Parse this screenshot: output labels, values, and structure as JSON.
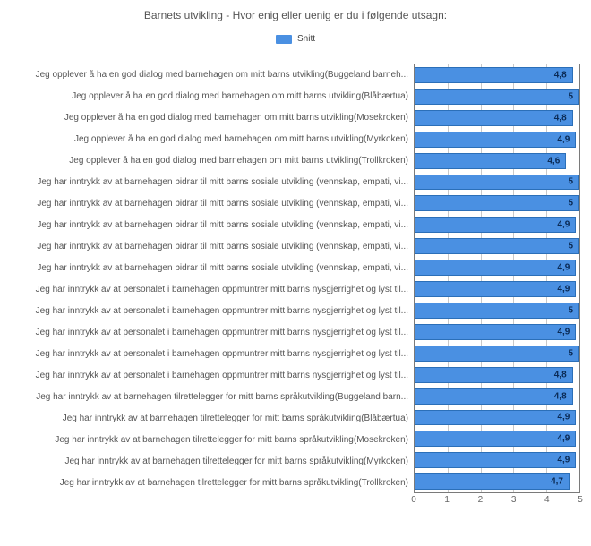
{
  "chart_data": {
    "type": "bar",
    "orientation": "horizontal",
    "title": "Barnets utvikling - Hvor enig eller uenig er du i følgende utsagn:",
    "legend_label": "Snitt",
    "xlabel": "",
    "ylabel": "",
    "xlim": [
      0,
      5
    ],
    "xticks": [
      0,
      1,
      2,
      3,
      4,
      5
    ],
    "categories": [
      "Jeg opplever å ha en god dialog med barnehagen om mitt barns utvikling(Buggeland barneh...",
      "Jeg opplever å ha en god dialog med barnehagen om mitt barns utvikling(Blåbærtua)",
      "Jeg opplever å ha en god dialog med barnehagen om mitt barns utvikling(Mosekroken)",
      "Jeg opplever å ha en god dialog med barnehagen om mitt barns utvikling(Myrkoken)",
      "Jeg opplever å ha en god dialog med barnehagen om mitt barns utvikling(Trollkroken)",
      "Jeg har inntrykk av at barnehagen bidrar til mitt barns sosiale utvikling (vennskap, empati, vi...",
      "Jeg har inntrykk av at barnehagen bidrar til mitt barns sosiale utvikling (vennskap, empati, vi...",
      "Jeg har inntrykk av at barnehagen bidrar til mitt barns sosiale utvikling (vennskap, empati, vi...",
      "Jeg har inntrykk av at barnehagen bidrar til mitt barns sosiale utvikling (vennskap, empati, vi...",
      "Jeg har inntrykk av at barnehagen bidrar til mitt barns sosiale utvikling (vennskap, empati, vi...",
      "Jeg har inntrykk av at personalet i barnehagen oppmuntrer mitt barns nysgjerrighet og lyst til...",
      "Jeg har inntrykk av at personalet i barnehagen oppmuntrer mitt barns nysgjerrighet og lyst til...",
      "Jeg har inntrykk av at personalet i barnehagen oppmuntrer mitt barns nysgjerrighet og lyst til...",
      "Jeg har inntrykk av at personalet i barnehagen oppmuntrer mitt barns nysgjerrighet og lyst til...",
      "Jeg har inntrykk av at personalet i barnehagen oppmuntrer mitt barns nysgjerrighet og lyst til...",
      "Jeg har inntrykk av at barnehagen tilrettelegger for mitt barns språkutvikling(Buggeland barn...",
      "Jeg har inntrykk av at barnehagen tilrettelegger for mitt barns språkutvikling(Blåbærtua)",
      "Jeg har inntrykk av at barnehagen tilrettelegger for mitt barns språkutvikling(Mosekroken)",
      "Jeg har inntrykk av at barnehagen tilrettelegger for mitt barns språkutvikling(Myrkoken)",
      "Jeg har inntrykk av at barnehagen tilrettelegger for mitt barns språkutvikling(Trollkroken)"
    ],
    "values": [
      4.8,
      5,
      4.8,
      4.9,
      4.6,
      5,
      5,
      4.9,
      5,
      4.9,
      4.9,
      5,
      4.9,
      5,
      4.8,
      4.8,
      4.9,
      4.9,
      4.9,
      4.7
    ],
    "value_labels": [
      "4,8",
      "5",
      "4,8",
      "4,9",
      "4,6",
      "5",
      "5",
      "4,9",
      "5",
      "4,9",
      "4,9",
      "5",
      "4,9",
      "5",
      "4,8",
      "4,8",
      "4,9",
      "4,9",
      "4,9",
      "4,7"
    ],
    "series_color": "#4a90e2"
  }
}
